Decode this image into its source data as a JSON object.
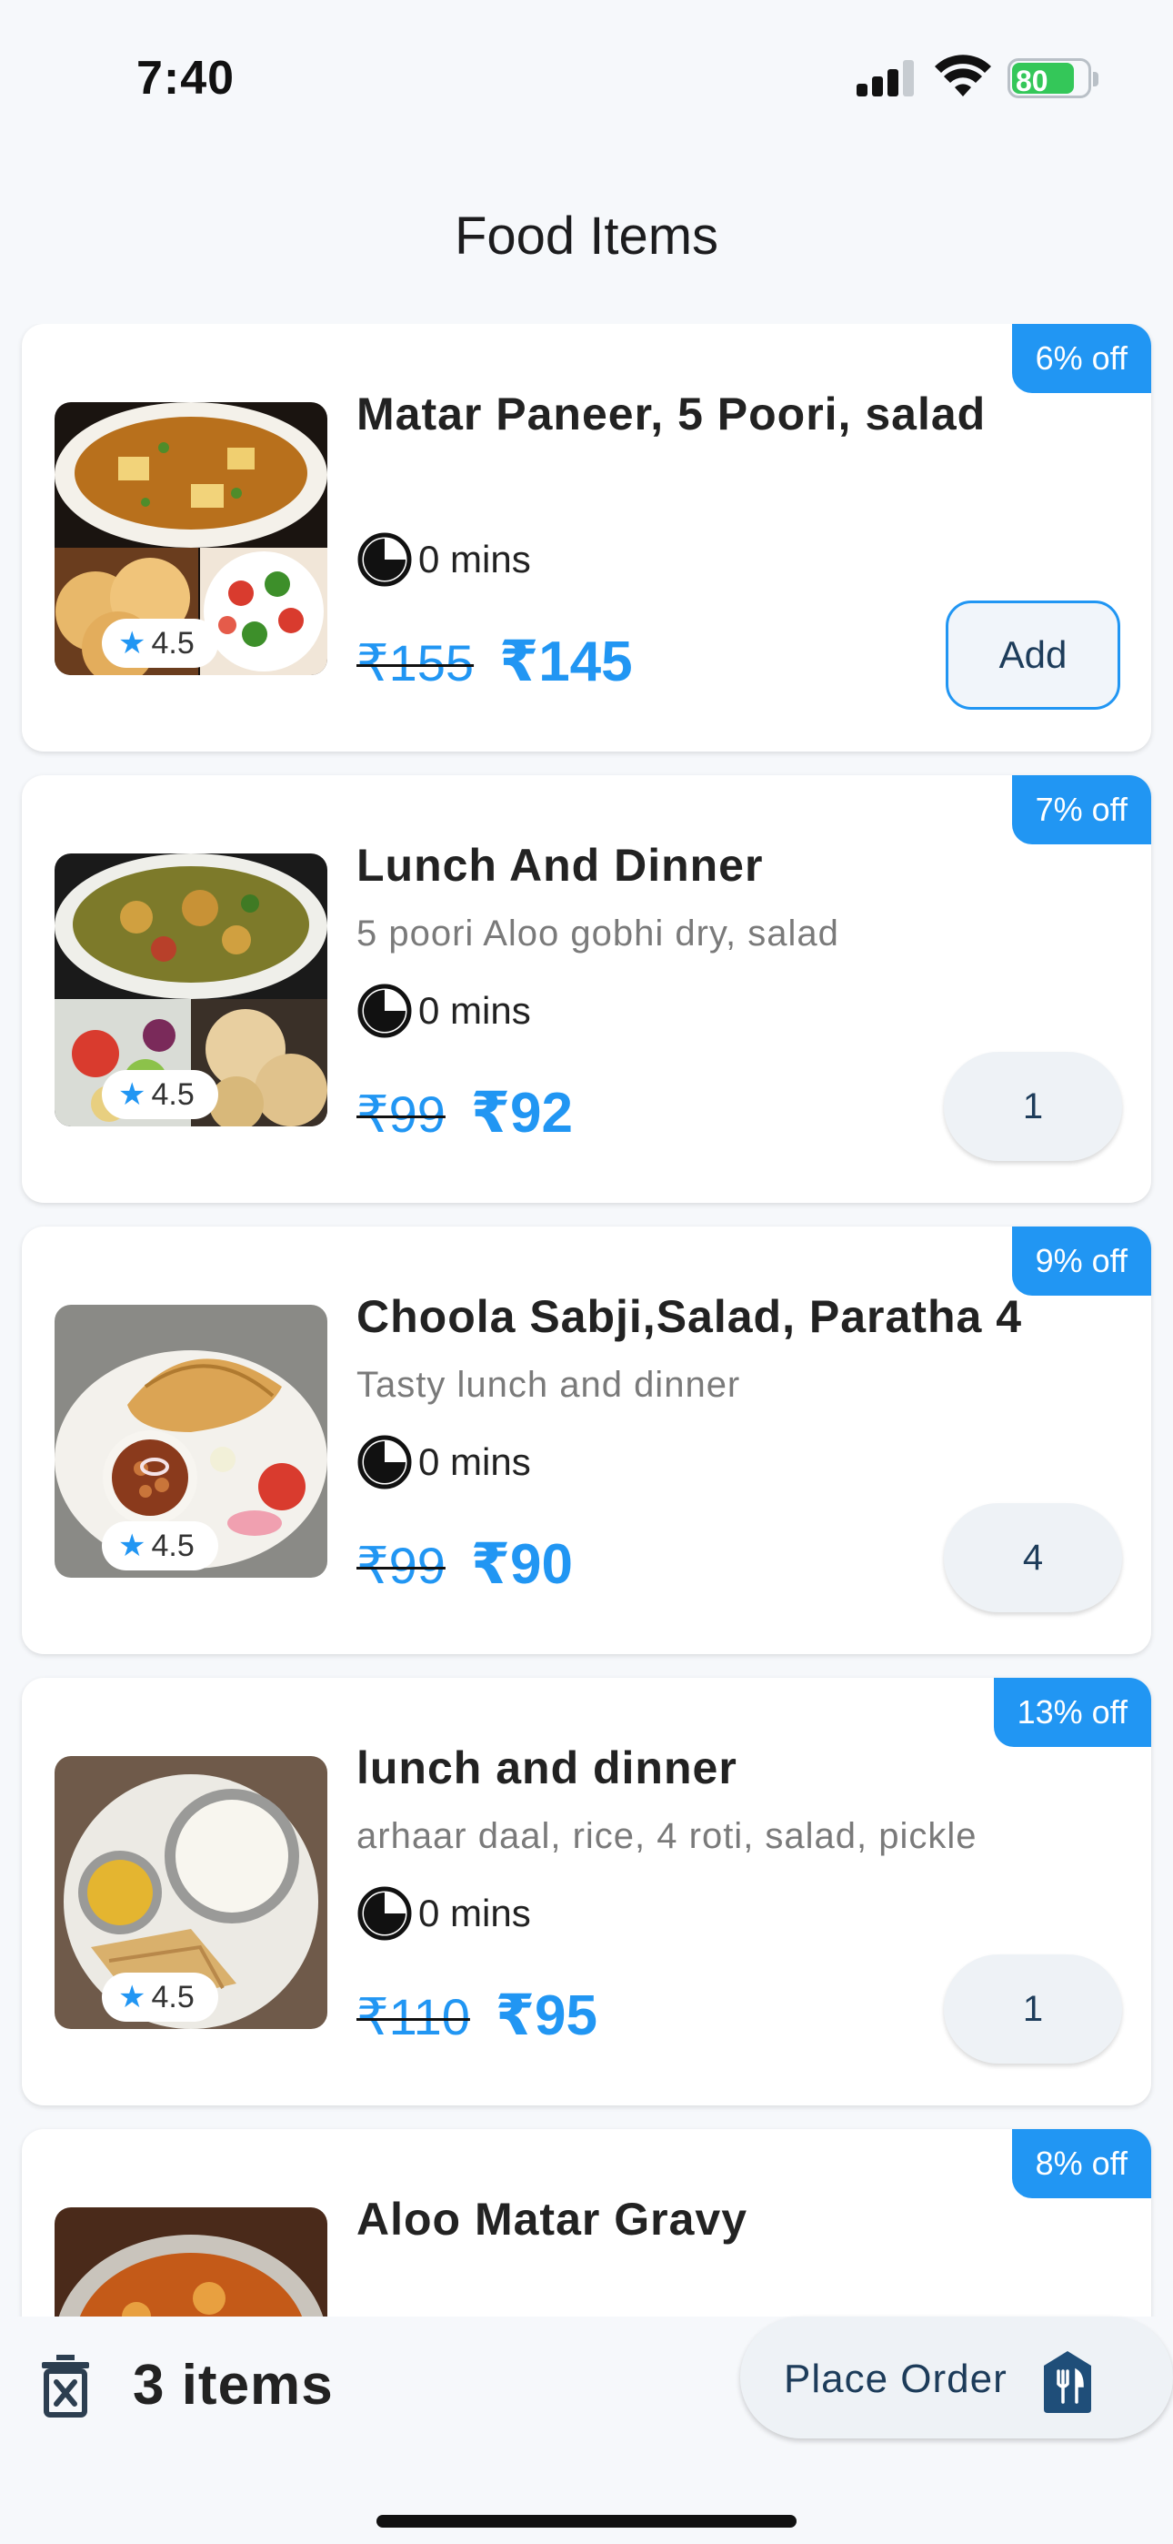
{
  "status_bar": {
    "time": "7:40",
    "battery": "80"
  },
  "header": {
    "title": "Food Items"
  },
  "items": [
    {
      "name": "Matar Paneer, 5 Poori, salad",
      "description": "",
      "time": "0 mins",
      "old_price": "₹155",
      "new_price": "₹145",
      "discount": "6% off",
      "rating": "4.5",
      "action": "Add"
    },
    {
      "name": "Lunch And Dinner",
      "description": "5 poori Aloo gobhi dry,  salad",
      "time": "0 mins",
      "old_price": "₹99",
      "new_price": "₹92",
      "discount": "7% off",
      "rating": "4.5",
      "action": "1"
    },
    {
      "name": "Choola Sabji,Salad, Paratha 4",
      "description": "Tasty lunch and dinner",
      "time": "0 mins",
      "old_price": "₹99",
      "new_price": "₹90",
      "discount": "9% off",
      "rating": "4.5",
      "action": "4"
    },
    {
      "name": "lunch and dinner",
      "description": "arhaar daal, rice, 4 roti, salad, pickle",
      "time": "0 mins",
      "old_price": "₹110",
      "new_price": "₹95",
      "discount": "13% off",
      "rating": "4.5",
      "action": "1"
    },
    {
      "name": "Aloo Matar Gravy",
      "discount": "8% off"
    }
  ],
  "bottom_bar": {
    "items_count": "3 items",
    "place_order_label": "Place Order"
  },
  "icons": {
    "delete": "trash-x-icon",
    "order": "restaurant-icon",
    "time": "clock-icon",
    "rating": "star-icon"
  },
  "colors": {
    "accent": "#2196f3",
    "button_text": "#1d3c5a",
    "battery": "#34c759"
  }
}
